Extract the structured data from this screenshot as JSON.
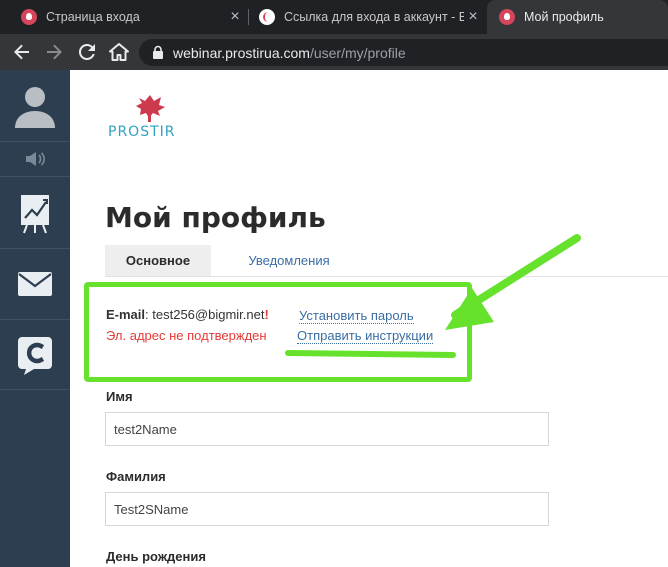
{
  "browser": {
    "tabs": [
      {
        "title": "Страница входа",
        "active": false
      },
      {
        "title": "Ссылка для входа в аккаунт - Ви",
        "active": false
      },
      {
        "title": "Мой профиль",
        "active": true
      }
    ],
    "url_host": "webinar.prostirua.com",
    "url_path": "/user/my/profile"
  },
  "sidebar": {
    "items": [
      "avatar-icon",
      "volume-icon",
      "presentation-board-icon",
      "mail-icon",
      "chat-icon"
    ]
  },
  "logo": {
    "text": "PROSTIR"
  },
  "page": {
    "title": "Мой профиль",
    "tabs": [
      {
        "label": "Основное",
        "active": true
      },
      {
        "label": "Уведомления",
        "active": false
      }
    ]
  },
  "email": {
    "label": "E-mail",
    "separator": ":",
    "value": "test256@bigmir.net",
    "warning_mark": "!",
    "status": "Эл. адрес не подтвержден",
    "set_password_link": "Установить пароль",
    "send_instructions_link": "Отправить инструкции"
  },
  "form": {
    "name_label": "Имя",
    "name_value": "test2Name",
    "surname_label": "Фамилия",
    "surname_value": "Test2SName",
    "birthday_label": "День рождения"
  },
  "colors": {
    "highlight": "#66e22c",
    "link": "#3b6ea5",
    "error": "#e53935",
    "sidebar": "#2d3e50"
  }
}
